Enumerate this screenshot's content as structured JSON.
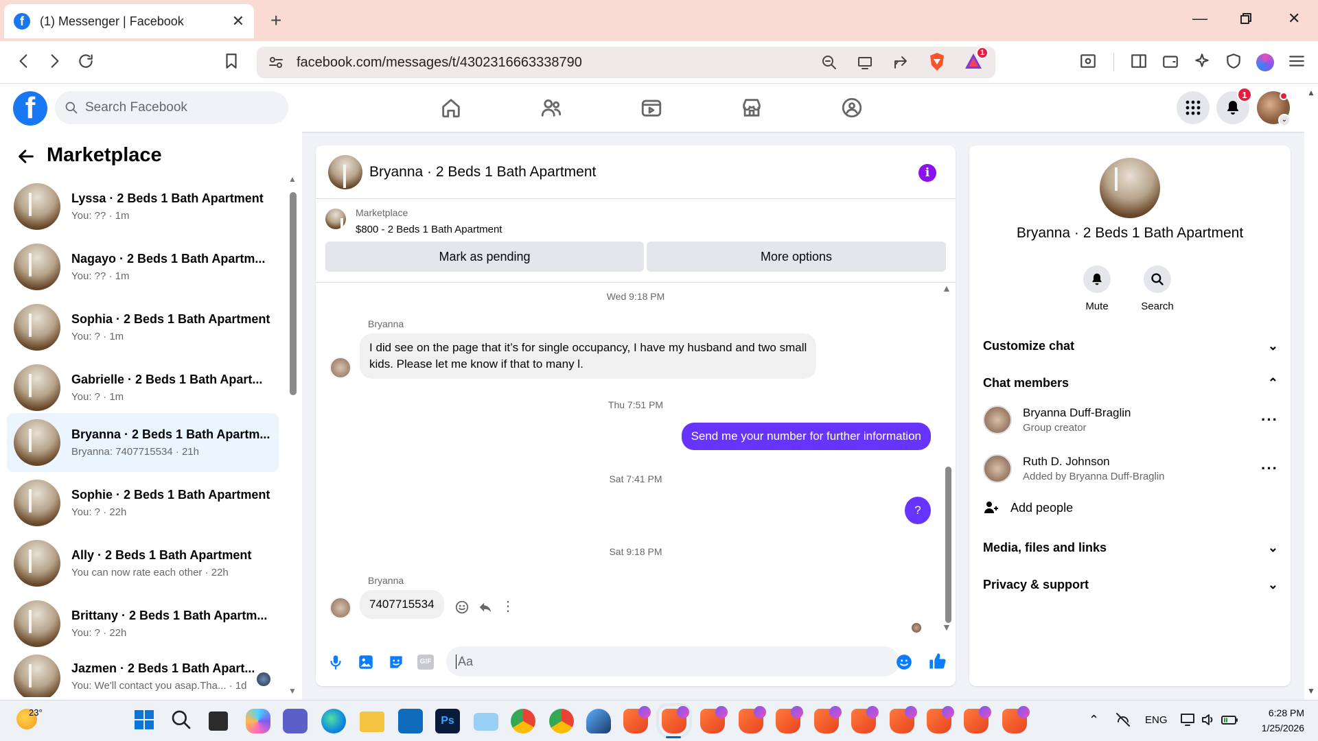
{
  "browser": {
    "tab_title": "(1) Messenger | Facebook",
    "url": "facebook.com/messages/t/4302316663338790",
    "extension_badge": "1"
  },
  "header": {
    "search_placeholder": "Search Facebook",
    "notification_count": "1"
  },
  "left": {
    "title": "Marketplace",
    "conversations": [
      {
        "name": "Lyssa · 2 Beds 1 Bath Apartment",
        "snippet": "You: ?? · 1m"
      },
      {
        "name": "Nagayo · 2 Beds 1 Bath Apartm...",
        "snippet": "You: ?? · 1m"
      },
      {
        "name": "Sophia · 2 Beds 1 Bath Apartment",
        "snippet": "You: ? · 1m"
      },
      {
        "name": "Gabrielle · 2 Beds 1 Bath Apart...",
        "snippet": "You: ? · 1m"
      },
      {
        "name": "Bryanna · 2 Beds 1 Bath Apartm...",
        "snippet": "Bryanna: 7407715534 · 21h"
      },
      {
        "name": "Sophie · 2 Beds 1 Bath Apartment",
        "snippet": "You: ? · 22h"
      },
      {
        "name": "Ally · 2 Beds 1 Bath Apartment",
        "snippet": "You can now rate each other · 22h"
      },
      {
        "name": "Brittany · 2 Beds 1 Bath Apartm...",
        "snippet": "You: ? · 22h"
      },
      {
        "name": "Jazmen · 2 Beds 1 Bath Apart...",
        "snippet": "You: We'll contact you asap.Tha... · 1d"
      }
    ]
  },
  "chat": {
    "title": "Bryanna · 2 Beds 1 Bath Apartment",
    "listing_source": "Marketplace",
    "listing_title": "$800 - 2 Beds 1 Bath Apartment",
    "mark_pending": "Mark as pending",
    "more_options": "More options",
    "day1": "Wed 9:18 PM",
    "sender1": "Bryanna",
    "msg1_line1": "I did see on the page that it’s for single occupancy, I have my husband and two small",
    "msg1_line2": "kids. Please let me know if that to many l.",
    "day2": "Thu 7:51 PM",
    "msg2": "Send me your number for further information",
    "day3": "Sat 7:41 PM",
    "msg3": "?",
    "day4": "Sat 9:18 PM",
    "sender2": "Bryanna",
    "msg4": "7407715534",
    "composer_placeholder": "Aa"
  },
  "info": {
    "name": "Bryanna · 2 Beds 1 Bath Apartment",
    "mute": "Mute",
    "search": "Search",
    "customize": "Customize chat",
    "members_title": "Chat members",
    "members": [
      {
        "name": "Bryanna Duff-Braglin",
        "sub": "Group creator"
      },
      {
        "name": "Ruth D. Johnson",
        "sub": "Added by Bryanna Duff-Braglin"
      }
    ],
    "add_people": "Add people",
    "media": "Media, files and links",
    "privacy": "Privacy & support"
  },
  "taskbar": {
    "weather": "23°",
    "lang": "ENG",
    "time": "6:28 PM",
    "date": "1/25/2026"
  },
  "colors": {
    "fb_blue": "#1877f2",
    "outgoing": "#6633ff",
    "active_row": "#ebf5ff"
  }
}
